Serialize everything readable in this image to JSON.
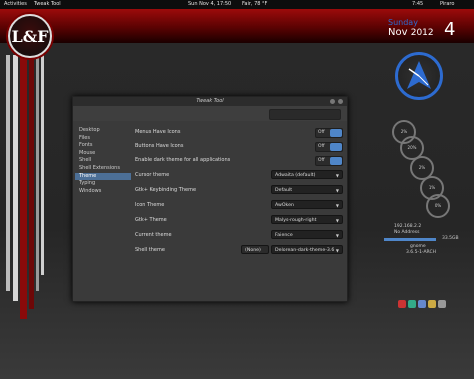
{
  "topbar": {
    "activities": "Activities",
    "app": "Tweak Tool",
    "datetime": "Sun Nov  4, 17:50",
    "weather": "Fair, 78 °F",
    "battery": "7:45",
    "user": "Piraro"
  },
  "logo": {
    "text": "L&F"
  },
  "window": {
    "title": "Tweak Tool"
  },
  "sidebar": {
    "items": [
      "Desktop",
      "Files",
      "Fonts",
      "Mouse",
      "Shell",
      "Shell Extensions",
      "Theme",
      "Typing",
      "Windows"
    ],
    "selected_index": 6
  },
  "settings": [
    {
      "label": "Menus Have Icons",
      "kind": "toggle",
      "value": "Off"
    },
    {
      "label": "Buttons Have Icons",
      "kind": "toggle",
      "value": "Off"
    },
    {
      "label": "Enable dark theme for all applications",
      "kind": "toggle",
      "value": "Off"
    },
    {
      "label": "Cursor theme",
      "kind": "combo",
      "value": "Adwaita (default)"
    },
    {
      "label": "Gtk+ Keybinding Theme",
      "kind": "combo",
      "value": "Default"
    },
    {
      "label": "Icon Theme",
      "kind": "combo",
      "value": "AwOken"
    },
    {
      "label": "Gtk+ Theme",
      "kind": "combo",
      "value": "Malys-rough-right"
    },
    {
      "label": "Current theme",
      "kind": "combo",
      "value": "Faience"
    },
    {
      "label": "Shell theme",
      "kind": "combo",
      "value": "Delorean-dark-theme-3.6"
    }
  ],
  "shell_theme_none": "(None)",
  "clock": {
    "weekday": "Sunday",
    "month": "Nov",
    "year": "2012",
    "day": "4"
  },
  "gauges": [
    "2%",
    "20%",
    "2%",
    "1%",
    "0%"
  ],
  "sysinfo": {
    "ip": "192.168.2.2",
    "ext": "No Address",
    "disk": "33.5GB",
    "os": "gnome",
    "kernel": "3.6.5-1-ARCH"
  },
  "colors": {
    "accent": "#4f86c9",
    "brand": "#9c0b0b"
  }
}
